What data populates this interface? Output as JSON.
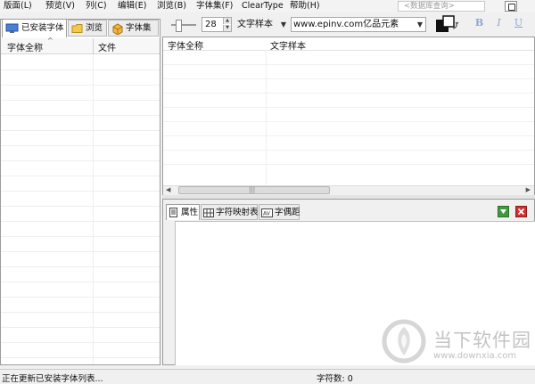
{
  "menu": [
    "版面(L)",
    "预览(V)",
    "列(C)",
    "编辑(E)",
    "浏览(B)",
    "字体集(F)",
    "ClearType",
    "帮助(H)"
  ],
  "search": {
    "placeholder": "<数据库查询>"
  },
  "toolbar": {
    "size_value": "28",
    "sample_label": "文字样本",
    "url_text": "www.epinv.com亿品元素",
    "bold": "B",
    "italic": "I",
    "underline": "U"
  },
  "left_tabs": [
    "已安装字体",
    "浏览",
    "字体集"
  ],
  "left_columns": [
    "字体全称",
    "文件"
  ],
  "right_columns": [
    "字体全称",
    "文字样本"
  ],
  "bottom_tabs": [
    "属性",
    "字符映射表",
    "字偶距"
  ],
  "status": {
    "message": "正在更新已安装字体列表...",
    "char_count": "字符数: 0"
  },
  "watermark": {
    "title": "当下软件园",
    "url": "www.downxia.com"
  },
  "colors": {
    "accent_green": "#3f9a3f",
    "close_red": "#d12f2f",
    "selection_blue": "#3a6ec9"
  }
}
